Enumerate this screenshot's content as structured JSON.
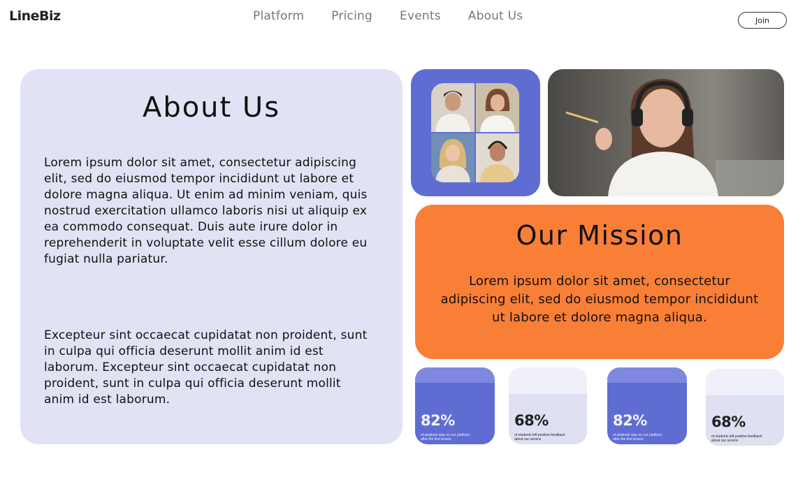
{
  "brand": {
    "logo": "LineBiz"
  },
  "nav": {
    "items": [
      "Platform",
      "Pricing",
      "Events",
      "About Us"
    ],
    "join_label": "Join"
  },
  "about": {
    "title": "About Us",
    "paragraph1": "Lorem ipsum dolor sit amet, consectetur adipiscing elit, sed do eiusmod tempor incididunt ut labore et dolore magna aliqua. Ut enim ad minim veniam, quis nostrud exercitation ullamco laboris nisi ut aliquip ex ea commodo consequat. Duis aute irure dolor in reprehenderit in voluptate velit esse cillum dolore eu fugiat nulla pariatur.",
    "paragraph2": "Excepteur sint occaecat cupidatat non proident, sunt in culpa qui officia deserunt mollit anim id est laborum. Excepteur sint occaecat cupidatat non proident, sunt in culpa qui officia deserunt mollit anim id est laborum."
  },
  "mission": {
    "title": "Our Mission",
    "text": "Lorem ipsum dolor sit amet, consectetur adipiscing elit, sed do eiusmod tempor incididunt ut labore et dolore magna aliqua."
  },
  "stats": [
    {
      "value": "82%",
      "caption": "of students stay on our platform after the first lesson"
    },
    {
      "value": "68%",
      "caption": "of students left positive feedback about our service"
    },
    {
      "value": "82%",
      "caption": "of students stay on our platform after the first lesson"
    },
    {
      "value": "68%",
      "caption": "of students left positive feedback about our service"
    }
  ],
  "colors": {
    "accent_blue": "#5f6dd3",
    "accent_orange": "#f97e36",
    "panel_lavender": "#e1e2f4"
  }
}
